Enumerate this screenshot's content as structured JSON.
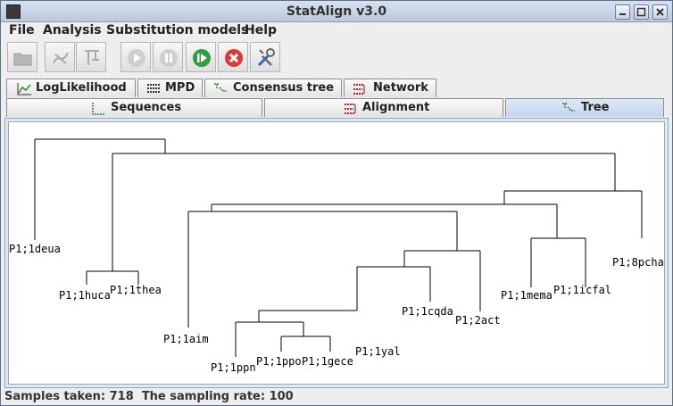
{
  "window": {
    "title": "StatAlign v3.0"
  },
  "menu": [
    {
      "name": "menu-file",
      "label": "File"
    },
    {
      "name": "menu-analysis",
      "label": "Analysis"
    },
    {
      "name": "menu-substitution-models",
      "label": "Substitution models"
    },
    {
      "name": "menu-help",
      "label": "Help"
    }
  ],
  "toolbar": {
    "buttons": [
      {
        "name": "open-button",
        "icon": "folder-icon",
        "enabled": false
      },
      {
        "name": "remove-sequences-button",
        "icon": "sequences-icon",
        "enabled": false
      },
      {
        "name": "remove-tree-button",
        "icon": "tree-icon",
        "enabled": false
      },
      {
        "name": "run-button",
        "icon": "play-icon",
        "enabled": false
      },
      {
        "name": "pause-button",
        "icon": "pause-icon",
        "enabled": false
      },
      {
        "name": "resume-button",
        "icon": "resume-icon",
        "enabled": true
      },
      {
        "name": "stop-button",
        "icon": "stop-icon",
        "enabled": true
      },
      {
        "name": "settings-button",
        "icon": "tools-icon",
        "enabled": true
      }
    ]
  },
  "tabs_top": [
    {
      "label": "LogLikelihood",
      "icon": "chart-icon"
    },
    {
      "label": "MPD",
      "icon": "list-icon"
    },
    {
      "label": "Consensus tree",
      "icon": "tree-icon"
    },
    {
      "label": "Network",
      "icon": "network-icon"
    }
  ],
  "tabs_bottom": [
    {
      "label": "Sequences",
      "icon": "sequences-icon"
    },
    {
      "label": "Alignment",
      "icon": "alignment-icon"
    },
    {
      "label": "Tree",
      "icon": "tree-icon",
      "active": true
    }
  ],
  "tree_leaves": [
    "P1;1deua",
    "P1;1huca",
    "P1;1thea",
    "P1;1aim",
    "P1;1ppn",
    "P1;1ppo",
    "P1;1gece",
    "P1;1yal",
    "P1;1cqda",
    "P1;2act",
    "P1;1mema",
    "P1;1icfal",
    "P1;8pcha"
  ],
  "status": {
    "samples_label": "Samples taken:",
    "samples_value": "718",
    "rate_label": "The sampling rate:",
    "rate_value": "100"
  },
  "colors": {
    "accent": "#c3d6ee",
    "play": "#2e9e3e",
    "stop": "#d93a3a"
  }
}
